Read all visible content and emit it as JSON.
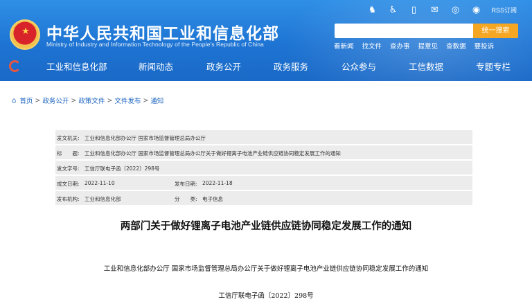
{
  "header": {
    "title": "中华人民共和国工业和信息化部",
    "subtitle": "Ministry of Industry and Information Technology of the People's Republic of China",
    "top_icons": [
      "wechat-icon",
      "accessibility-icon",
      "mobile-icon",
      "mail-icon",
      "weixin-icon",
      "weibo-icon"
    ],
    "rss_label": "RSS订阅",
    "search": {
      "placeholder": "",
      "button": "统一搜索"
    },
    "quick_links": [
      "看新闻",
      "找文件",
      "查办事",
      "提意见",
      "查数据",
      "要投诉"
    ],
    "accent": "#1e74d3",
    "search_button_color": "#f5a623"
  },
  "nav": {
    "items": [
      "工业和信息化部",
      "新闻动态",
      "政务公开",
      "政务服务",
      "公众参与",
      "工信数据",
      "专题专栏"
    ]
  },
  "breadcrumb": [
    "首页",
    "政务公开",
    "政策文件",
    "文件发布",
    "通知"
  ],
  "meta": {
    "issuer_label": "发文机关:",
    "issuer": "工业和信息化部办公厅 国家市场监督管理总局办公厅",
    "title_label": "标　　题:",
    "title": "工业和信息化部办公厅 国家市场监督管理总局办公厅关于做好锂离子电池产业链供应链协同稳定发展工作的通知",
    "doc_no_label": "发文字号:",
    "doc_no": "工信厅联电子函〔2022〕298号",
    "written_label": "成文日期:",
    "written": "2022-11-10",
    "published_label": "发布日期:",
    "published": "2022-11-18",
    "org_label": "发布机构:",
    "org": "工业和信息化部",
    "category_label": "分　　类:",
    "category": "电子信息"
  },
  "document": {
    "title": "两部门关于做好锂离子电池产业链供应链协同稳定发展工作的通知",
    "intro": "工业和信息化部办公厅  国家市场监督管理总局办公厅关于做好锂离子电池产业链供应链协同稳定发展工作的通知",
    "number": "工信厅联电子函〔2022〕298号"
  }
}
